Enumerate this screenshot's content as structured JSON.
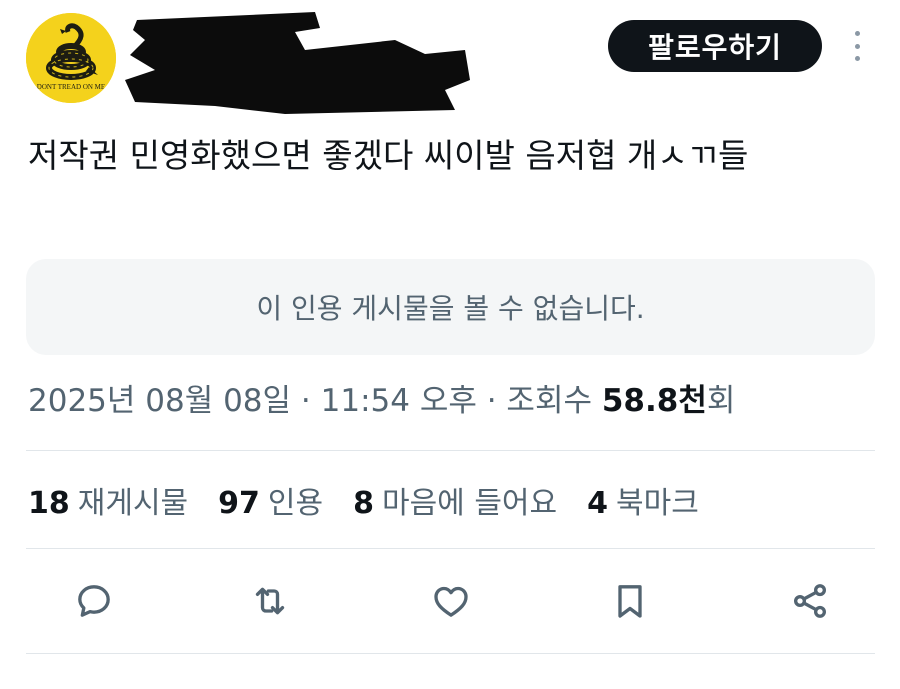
{
  "header": {
    "avatar_icon": "gadsden-flag-avatar-icon",
    "avatar_caption": "DONT TREAD ON ME",
    "follow_label": "팔로우하기",
    "more_icon": "more-vertical-icon"
  },
  "tweet": {
    "text": "저작권 민영화했으면 좋겠다 씨이발 음저협 개ㅅㄲ들",
    "quote_unavailable": "이 인용 게시물을 볼 수 없습니다."
  },
  "meta": {
    "date": "2025년 08월 08일",
    "sep1": " · ",
    "time": "11:54 오후",
    "sep2": " · ",
    "views_label": "조회수 ",
    "views_value": "58.8천",
    "views_suffix": "회"
  },
  "stats": [
    {
      "count": "18",
      "label": "재게시물"
    },
    {
      "count": "97",
      "label": "인용"
    },
    {
      "count": "8",
      "label": "마음에 들어요"
    },
    {
      "count": "4",
      "label": "북마크"
    }
  ],
  "actions": [
    {
      "icon": "reply-icon"
    },
    {
      "icon": "retweet-icon"
    },
    {
      "icon": "like-icon"
    },
    {
      "icon": "bookmark-icon"
    },
    {
      "icon": "share-icon"
    }
  ],
  "colors": {
    "primary_text": "#0f1419",
    "secondary_text": "#536471",
    "quote_bg": "#f4f6f7",
    "avatar_bg": "#f4d21c",
    "button_bg": "#0f1419"
  }
}
